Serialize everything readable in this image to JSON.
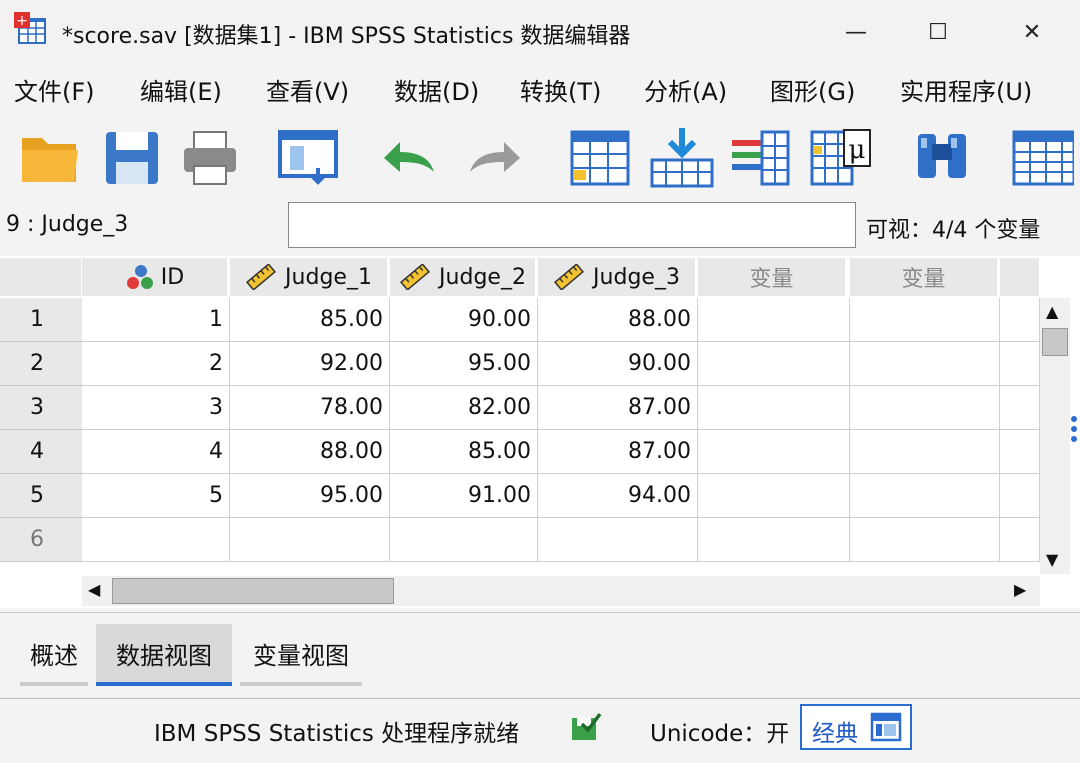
{
  "window": {
    "title": "*score.sav [数据集1] - IBM SPSS Statistics 数据编辑器",
    "minimize": "—",
    "maximize": "☐",
    "close": "✕"
  },
  "menu": [
    "文件(F)",
    "编辑(E)",
    "查看(V)",
    "数据(D)",
    "转换(T)",
    "分析(A)",
    "图形(G)",
    "实用程序(U)"
  ],
  "toolbar": {
    "icons": [
      "open-folder-icon",
      "save-icon",
      "print-icon",
      "recall-dialog-icon",
      "undo-icon",
      "redo-icon",
      "goto-case-icon",
      "goto-variable-icon",
      "variables-icon",
      "descriptive-stats-icon",
      "find-icon",
      "split-file-icon"
    ]
  },
  "cell_editor": {
    "reference": "9 : Judge_3",
    "value": "",
    "visible_vars": "可视：4/4 个变量"
  },
  "grid": {
    "columns": [
      {
        "label": "ID",
        "icon": "nominal-icon"
      },
      {
        "label": "Judge_1",
        "icon": "scale-ruler-icon"
      },
      {
        "label": "Judge_2",
        "icon": "scale-ruler-icon"
      },
      {
        "label": "Judge_3",
        "icon": "scale-ruler-icon"
      },
      {
        "label": "变量",
        "icon": ""
      },
      {
        "label": "变量",
        "icon": ""
      }
    ],
    "rows": [
      {
        "num": "1",
        "cells": [
          "1",
          "85.00",
          "90.00",
          "88.00",
          "",
          ""
        ]
      },
      {
        "num": "2",
        "cells": [
          "2",
          "92.00",
          "95.00",
          "90.00",
          "",
          ""
        ]
      },
      {
        "num": "3",
        "cells": [
          "3",
          "78.00",
          "82.00",
          "87.00",
          "",
          ""
        ]
      },
      {
        "num": "4",
        "cells": [
          "4",
          "88.00",
          "85.00",
          "87.00",
          "",
          ""
        ]
      },
      {
        "num": "5",
        "cells": [
          "5",
          "95.00",
          "91.00",
          "94.00",
          "",
          ""
        ]
      },
      {
        "num": "6",
        "cells": [
          "",
          "",
          "",
          "",
          "",
          ""
        ]
      }
    ]
  },
  "tabs": [
    "概述",
    "数据视图",
    "变量视图"
  ],
  "active_tab": "数据视图",
  "status": {
    "processor": "IBM SPSS Statistics 处理程序就绪",
    "unicode": "Unicode：开",
    "mode": "经典"
  },
  "colors": {
    "accent": "#2a6cd0",
    "active_tab_bg": "#d9d9d9"
  }
}
